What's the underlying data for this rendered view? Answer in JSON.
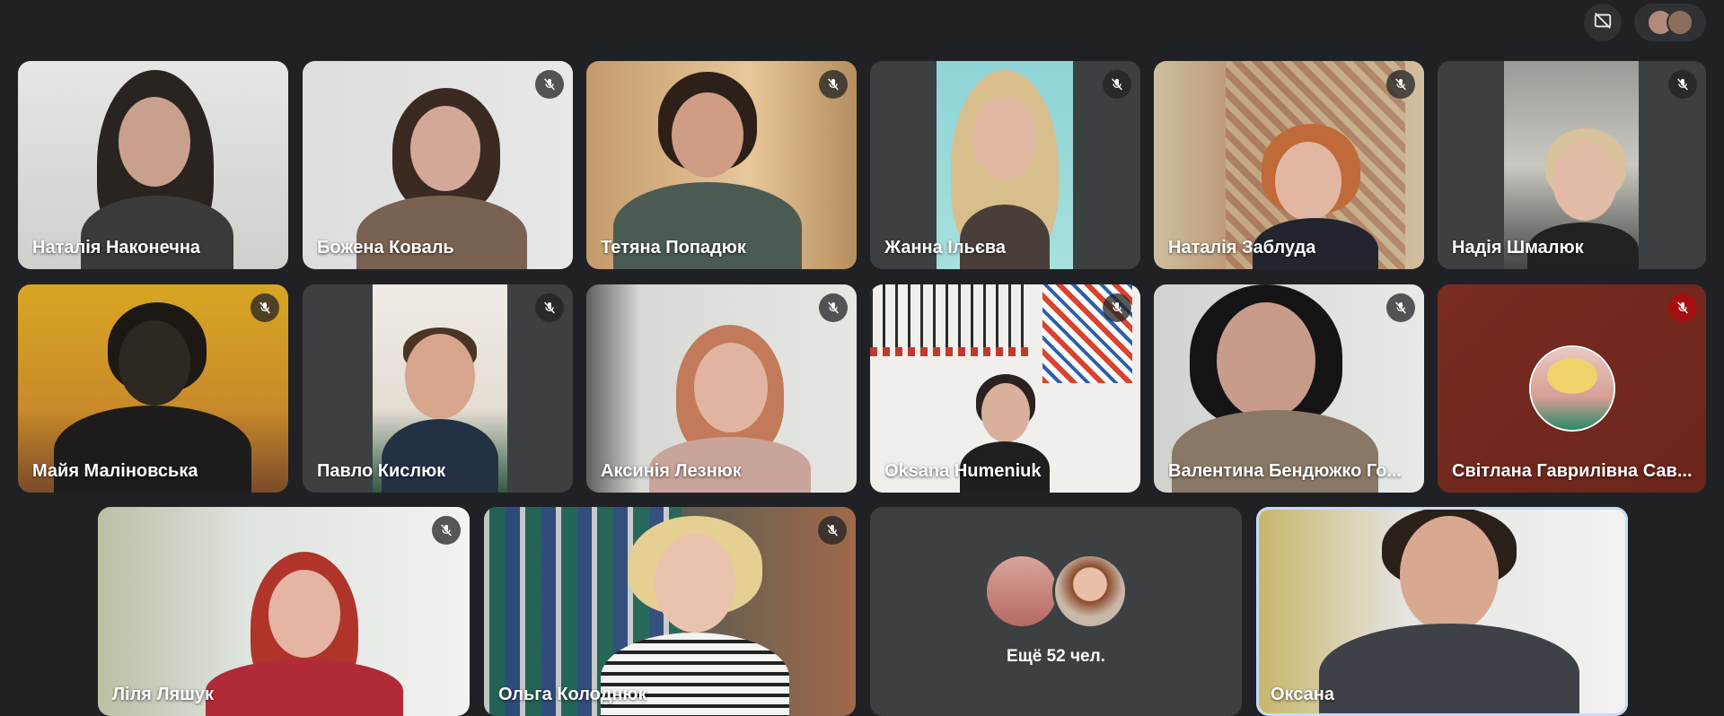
{
  "colors": {
    "background": "#202124",
    "tile": "#3c4043",
    "muted_red": "#a50e0e",
    "active_border": "#c6dafc"
  },
  "topbar": {
    "hide_self_icon": "hide-tiles-icon",
    "people_icon": "participant-avatars"
  },
  "participants": [
    {
      "name": "Наталія Наконечна",
      "muted": false
    },
    {
      "name": "Божена Коваль",
      "muted": true
    },
    {
      "name": "Тетяна Попадюк",
      "muted": true
    },
    {
      "name": "Жанна Ільєва",
      "muted": true
    },
    {
      "name": "Наталія Заблуда",
      "muted": true
    },
    {
      "name": "Надія Шмалюк",
      "muted": true
    },
    {
      "name": "Майя Маліновська",
      "muted": true
    },
    {
      "name": "Павло Кислюк",
      "muted": true
    },
    {
      "name": "Аксинія Лезнюк",
      "muted": true
    },
    {
      "name": "Oksana Humeniuk",
      "muted": true
    },
    {
      "name": "Валентина Бендюжко Го...",
      "muted": true
    },
    {
      "name": "Світлана Гаврилівна Сав...",
      "muted": true,
      "camera_off": true
    },
    {
      "name": "Ліля Ляшук",
      "muted": true
    },
    {
      "name": "Ольга Колоднюк",
      "muted": true
    },
    {
      "name": "Оксана",
      "muted": false,
      "active_speaker": true
    }
  ],
  "overflow": {
    "label": "Ещё 52 чел."
  }
}
